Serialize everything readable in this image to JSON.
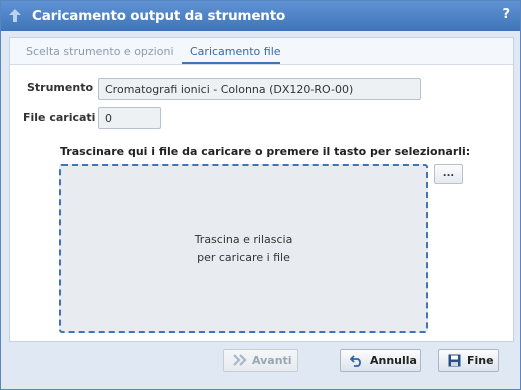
{
  "window": {
    "title": "Caricamento output da strumento",
    "help_label": "?"
  },
  "tabs": [
    {
      "label": "Scelta strumento e opzioni",
      "active": false
    },
    {
      "label": "Caricamento file",
      "active": true
    }
  ],
  "form": {
    "strumento_label": "Strumento",
    "strumento_value": "Cromatografi ionici - Colonna (DX120-RO-00)",
    "file_caricati_label": "File caricati",
    "file_caricati_value": "0"
  },
  "upload": {
    "instructions": "Trascinare qui i file da caricare o premere il tasto per selezionarli:",
    "dropzone_line1": "Trascina e rilascia",
    "dropzone_line2": "per caricare i file",
    "browse_label": "..."
  },
  "footer": {
    "avanti_label": "Avanti",
    "annulla_label": "Annulla",
    "fine_label": "Fine"
  },
  "colors": {
    "accent": "#3f74b9",
    "titlebar": "#4a7fc4",
    "panel": "#dfe8f3"
  }
}
